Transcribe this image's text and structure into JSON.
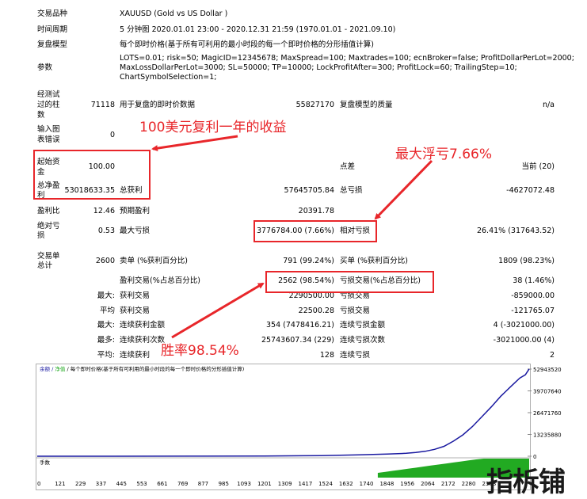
{
  "info": {
    "symbol_label": "交易品种",
    "symbol_value": "XAUUSD (Gold vs US Dollar )",
    "period_label": "时间周期",
    "period_value": "5 分钟图 2020.01.01 23:00 - 2020.12.31 21:59 (1970.01.01 - 2021.09.10)",
    "model_label": "复盘模型",
    "model_value": "每个即时价格(基于所有可利用的最小时段的每一个即时价格的分形插值计算)",
    "params_label": "参数",
    "params_line1": "LOTS=0.01; risk=50; MagicID=12345678; MaxSpread=100; Maxtrades=100; ecnBroker=false; ProfitDollarPerLot=2000;",
    "params_line2": "MaxLossDollarPerLot=3000; SL=50000; TP=10000; LockProfitAfter=300; ProfitLock=60; TrailingStep=10;",
    "params_line3": "ChartSymbolSelection=1;"
  },
  "stats": {
    "bars_label_1": "经测试",
    "bars_label_2": "过的柱",
    "bars_label_3": "数",
    "bars_value": "71118",
    "ticks_label": "用于复盘的即时价数据",
    "ticks_value": "55827170",
    "quality_label": "复盘模型的质量",
    "quality_value": "n/a",
    "mismatch_label_1": "输入图",
    "mismatch_label_2": "表错误",
    "mismatch_value": "0",
    "deposit_label_1": "起始资",
    "deposit_label_2": "金",
    "deposit_value": "100.00",
    "spread_label": "点差",
    "spread_value": "当前 (20)",
    "net_label_1": "总净盈",
    "net_label_2": "利",
    "net_value": "53018633.35",
    "gross_profit_label": "总获利",
    "gross_profit_value": "57645705.84",
    "gross_loss_label": "总亏损",
    "gross_loss_value": "-4627072.48",
    "pf_label": "盈利比",
    "pf_value": "12.46",
    "payoff_label": "预期盈利",
    "payoff_value": "20391.78",
    "abs_dd_label_1": "绝对亏",
    "abs_dd_label_2": "损",
    "abs_dd_value": "0.53",
    "max_dd_label": "最大亏损",
    "max_dd_value": "3776784.00 (7.66%)",
    "rel_dd_label": "相对亏损",
    "rel_dd_value": "26.41% (317643.52)",
    "total_trades_label_1": "交易单",
    "total_trades_label_2": "总计",
    "total_trades_value": "2600",
    "short_label": "卖单 (%获利百分比)",
    "short_value": "791 (99.24%)",
    "long_label": "买单 (%获利百分比)",
    "long_value": "1809 (98.23%)",
    "profit_trades_label": "盈利交易(%占总百分比)",
    "profit_trades_value": "2562 (98.54%)",
    "loss_trades_label": "亏损交易(%占总百分比)",
    "loss_trades_value": "38 (1.46%)",
    "largest_label": "最大:",
    "largest_profit_label": "获利交易",
    "largest_profit_value": "2290500.00",
    "largest_loss_label": "亏损交易",
    "largest_loss_value": "-859000.00",
    "average_label": "平均",
    "avg_profit_label": "获利交易",
    "avg_profit_value": "22500.28",
    "avg_loss_label": "亏损交易",
    "avg_loss_value": "-121765.07",
    "max_label": "最大:",
    "max_cons_wins_label": "连续获利金额",
    "max_cons_wins_value": "354 (7478416.21)",
    "max_cons_losses_label": "连续亏损金额",
    "max_cons_losses_value": "4 (-3021000.00)",
    "most_label": "最多:",
    "max_cons_profit_label": "连续获利次数",
    "max_cons_profit_value": "25743607.34 (229)",
    "max_cons_loss_label": "连续亏损次数",
    "max_cons_loss_value": "-3021000.00 (4)",
    "avg2_label": "平均:",
    "avg_cons_wins_label": "连续获利",
    "avg_cons_wins_value": "128",
    "avg_cons_losses_label": "连续亏损",
    "avg_cons_losses_value": "2"
  },
  "annotations": {
    "compound": "100美元复利一年的收益",
    "max_drawdown": "最大浮亏7.66%",
    "win_rate": "胜率98.54%",
    "color": "#e8262a"
  },
  "chart": {
    "legend_balance": "余额",
    "legend_equity": "净值",
    "legend_text": "每个即时价格(基于所有可利用的最小时段的每一个即时价格的分形插值计算)",
    "lots_label": "手数",
    "y_ticks": [
      "52943520",
      "39707640",
      "26471760",
      "13235880",
      "0"
    ],
    "x_ticks": [
      "0",
      "121",
      "229",
      "337",
      "445",
      "553",
      "661",
      "769",
      "877",
      "985",
      "1093",
      "1201",
      "1309",
      "1417",
      "1524",
      "1632",
      "1740",
      "1848",
      "1956",
      "2064",
      "2172",
      "2280",
      "2388"
    ],
    "balance_color": "#1a1aa0",
    "volume_color": "#22aa22",
    "watermark": "指柝铺"
  },
  "chart_data": {
    "type": "line",
    "title": "",
    "xlabel": "",
    "ylabel": "",
    "ylim": [
      0,
      52943520
    ],
    "xlim": [
      0,
      2600
    ],
    "series": [
      {
        "name": "余额",
        "x": [
          0,
          400,
          800,
          1200,
          1500,
          1700,
          1850,
          1950,
          2000,
          2050,
          2100,
          2150,
          2200,
          2250,
          2300,
          2350,
          2400,
          2450,
          2500,
          2550,
          2580,
          2600
        ],
        "y": [
          100,
          2000,
          30000,
          150000,
          400000,
          800000,
          1300000,
          1800000,
          2300000,
          3000000,
          4200000,
          6000000,
          9200000,
          13000000,
          18000000,
          24000000,
          30000000,
          36500000,
          42000000,
          47500000,
          49500000,
          53018733
        ]
      }
    ]
  }
}
